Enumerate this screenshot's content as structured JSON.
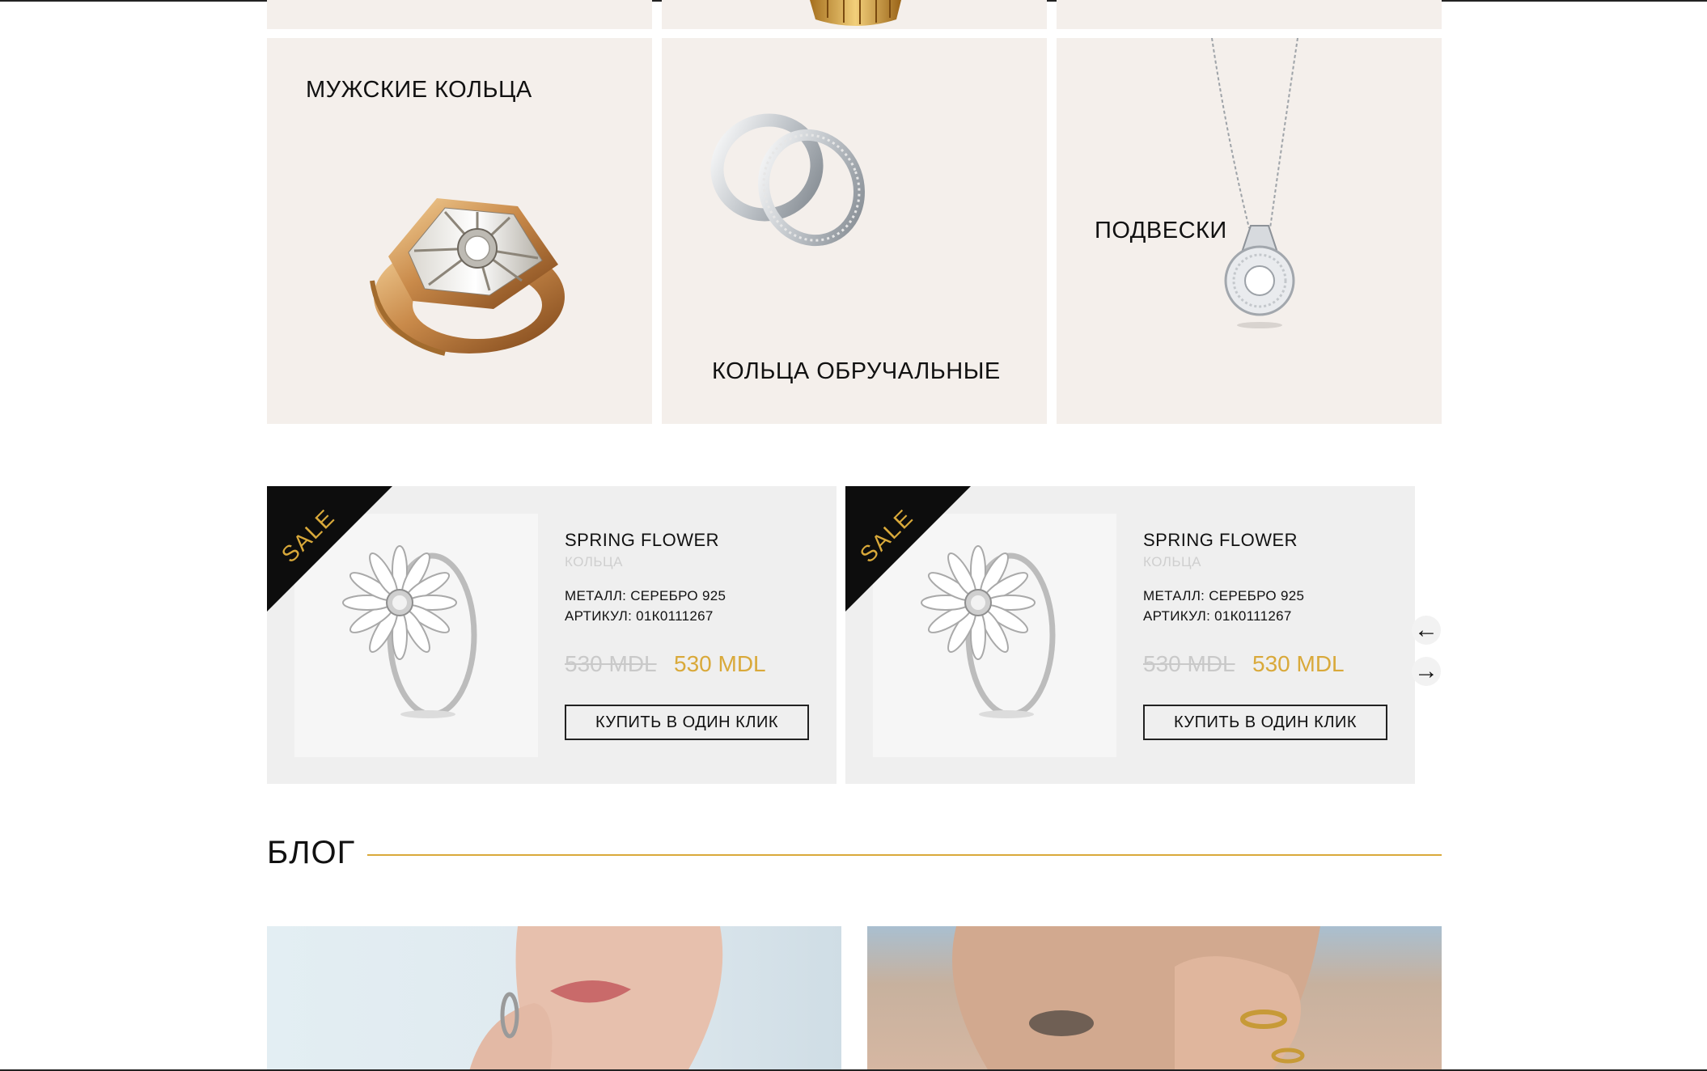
{
  "categories": [
    {
      "title": "МУЖСКИЕ КОЛЬЦА",
      "image": "mens-ring-image"
    },
    {
      "title": "КОЛЬЦА ОБРУЧАЛЬНЫЕ",
      "image": "wedding-rings-image"
    },
    {
      "title": "ПОДВЕСКИ",
      "image": "pendant-image"
    }
  ],
  "products": [
    {
      "badge": "SALE",
      "name": "SPRING FLOWER",
      "category": "КОЛЬЦА",
      "metal": "МЕТАЛЛ: СЕРЕБРО 925",
      "sku": "АРТИКУЛ: 01К0111267",
      "price_old": "530 MDL",
      "price_new": "530 MDL",
      "buy_label": "КУПИТЬ В ОДИН КЛИК"
    },
    {
      "badge": "SALE",
      "name": "SPRING FLOWER",
      "category": "КОЛЬЦА",
      "metal": "МЕТАЛЛ: СЕРЕБРО 925",
      "sku": "АРТИКУЛ: 01К0111267",
      "price_old": "530 MDL",
      "price_new": "530 MDL",
      "buy_label": "КУПИТЬ В ОДИН КЛИК"
    }
  ],
  "slider": {
    "prev_icon": "←",
    "next_icon": "→"
  },
  "blog": {
    "title": "БЛОГ"
  },
  "colors": {
    "accent": "#d9a93a",
    "tile_bg": "#f4efeb",
    "card_bg": "#efefef",
    "text": "#111111"
  }
}
